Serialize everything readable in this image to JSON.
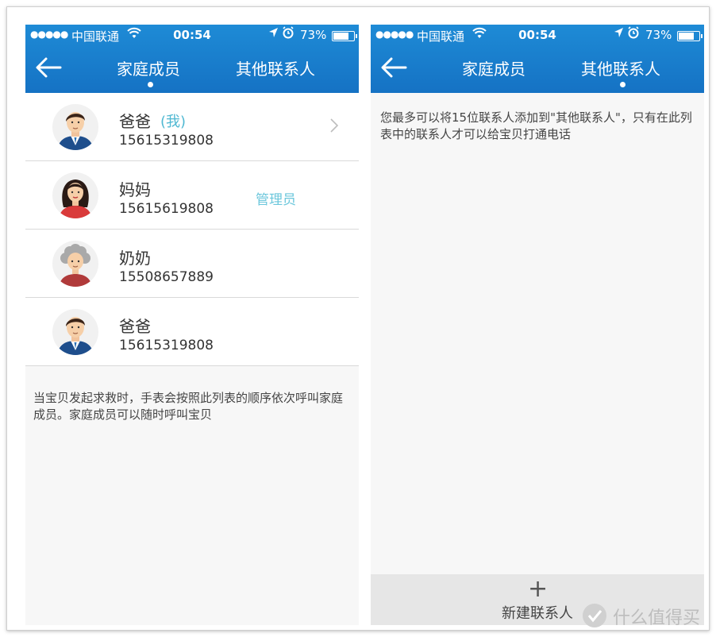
{
  "left_screen": {
    "status_bar": {
      "signal": "●●●●●",
      "carrier": "中国联通",
      "time": "00:54",
      "battery": "73%",
      "location_icon": "location-arrow-icon",
      "alarm_icon": "alarm-icon",
      "wifi_icon": "wifi-icon"
    },
    "nav": {
      "back_icon": "back-arrow-icon",
      "tabs": [
        {
          "label": "家庭成员",
          "active": true
        },
        {
          "label": "其他联系人",
          "active": false
        }
      ]
    },
    "members": [
      {
        "name": "爸爸",
        "tag": "(我)",
        "phone": "15615319808",
        "avatar": "man-avatar",
        "has_chevron": true
      },
      {
        "name": "妈妈",
        "role": "管理员",
        "phone": "15615619808",
        "avatar": "woman-avatar"
      },
      {
        "name": "奶奶",
        "phone": "15508657889",
        "avatar": "grandma-avatar"
      },
      {
        "name": "爸爸",
        "phone": "15615319808",
        "avatar": "man-avatar"
      }
    ],
    "note": "当宝贝发起求救时，手表会按照此列表的顺序依次呼叫家庭成员。家庭成员可以随时呼叫宝贝"
  },
  "right_screen": {
    "status_bar": {
      "signal": "●●●●●",
      "carrier": "中国联通",
      "time": "00:54",
      "battery": "73%"
    },
    "nav": {
      "tabs": [
        {
          "label": "家庭成员",
          "active": false
        },
        {
          "label": "其他联系人",
          "active": true
        }
      ]
    },
    "note": "您最多可以将15位联系人添加到\"其他联系人\"，只有在此列表中的联系人才可以给宝贝打通电话",
    "new_contact": {
      "plus": "+",
      "label": "新建联系人"
    }
  },
  "watermark": "什么值得买",
  "colors": {
    "header": "#1a80cf",
    "accent": "#4fb8d2",
    "background": "#f7f7f7"
  }
}
